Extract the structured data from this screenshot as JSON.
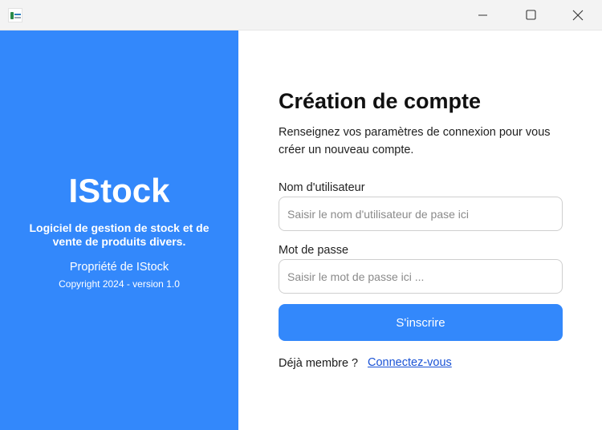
{
  "window": {
    "minimize_icon": "minimize-icon",
    "maximize_icon": "maximize-icon",
    "close_icon": "close-icon"
  },
  "colors": {
    "accent": "#3388fb",
    "link": "#1a53d6",
    "titlebar": "#f3f3f3"
  },
  "sidebar": {
    "brand": "IStock",
    "tagline": "Logiciel de gestion de stock et de vente de produits divers.",
    "owner": "Propriété de IStock",
    "copyright": "Copyright 2024 - version 1.0"
  },
  "form": {
    "title": "Création de compte",
    "description": "Renseignez vos paramètres de connexion pour vous créer un nouveau compte.",
    "username_label": "Nom d'utilisateur",
    "username_placeholder": "Saisir le nom d'utilisateur de pase ici",
    "username_value": "",
    "password_label": "Mot de passe",
    "password_placeholder": "Saisir le mot de passe ici ...",
    "password_value": "",
    "submit_label": "S'inscrire",
    "member_text": "Déjà membre ?",
    "login_link": "Connectez-vous"
  }
}
